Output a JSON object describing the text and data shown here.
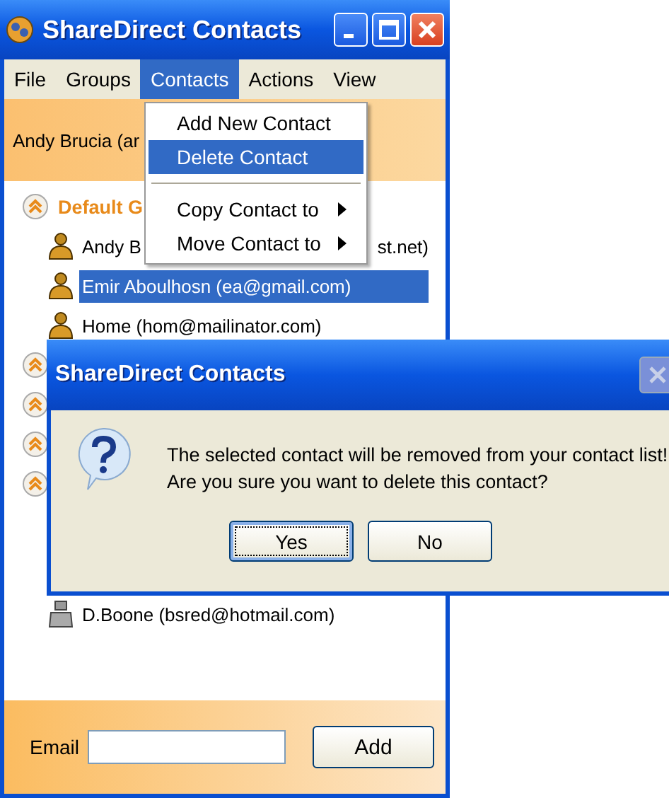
{
  "window": {
    "title": "ShareDirect Contacts"
  },
  "menu_bar": [
    {
      "label": "File",
      "selected": false
    },
    {
      "label": "Groups",
      "selected": false
    },
    {
      "label": "Contacts",
      "selected": true
    },
    {
      "label": "Actions",
      "selected": false
    },
    {
      "label": "View",
      "selected": false
    }
  ],
  "contacts_menu": [
    {
      "kind": "item",
      "label": "Add New Contact",
      "selected": false
    },
    {
      "kind": "item",
      "label": "Delete Contact",
      "selected": true
    },
    {
      "kind": "separator"
    },
    {
      "kind": "submenu",
      "label": "Copy Contact to",
      "selected": false
    },
    {
      "kind": "submenu",
      "label": "Move Contact to",
      "selected": false
    }
  ],
  "header": {
    "user": "Andy Brucia (ar"
  },
  "groups": [
    {
      "label": "Default G",
      "expanded": true,
      "contacts": [
        {
          "name": "Andy B",
          "tail": "st.net)",
          "kind": "online",
          "selected": false
        },
        {
          "name": "Emir Aboulhosn (ea@gmail.com)",
          "kind": "online",
          "selected": true
        },
        {
          "name": "Home (hom@mailinator.com)",
          "kind": "online",
          "selected": false
        }
      ]
    },
    {
      "expanded": true
    },
    {
      "expanded": true
    },
    {
      "expanded": true
    },
    {
      "expanded": true,
      "contacts": [
        {
          "name": "D.Boone (bsred@hotmail.com)",
          "kind": "offline",
          "selected": false
        }
      ]
    }
  ],
  "email_bar": {
    "label": "Email",
    "button": "Add"
  },
  "dialog": {
    "title": "ShareDirect Contacts",
    "close_disabled": true,
    "message": [
      "The selected contact will be removed from your contact list!",
      "Are you sure you want to delete this contact?"
    ],
    "buttons": [
      {
        "label": "Yes",
        "focused": true
      },
      {
        "label": "No",
        "focused": false
      }
    ]
  }
}
